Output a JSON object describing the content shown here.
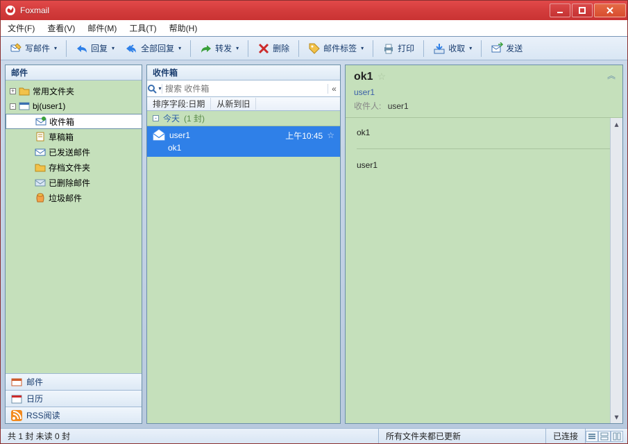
{
  "app": {
    "title": "Foxmail"
  },
  "menu": {
    "file": "文件(F)",
    "view": "查看(V)",
    "mail": "邮件(M)",
    "tools": "工具(T)",
    "help": "帮助(H)"
  },
  "toolbar": {
    "compose": "写邮件",
    "reply": "回复",
    "reply_all": "全部回复",
    "forward": "转发",
    "delete": "删除",
    "tags": "邮件标签",
    "print": "打印",
    "receive": "收取",
    "send": "发送"
  },
  "sidebar": {
    "header": "邮件",
    "tree": {
      "fav": "常用文件夹",
      "account": "bj(user1)",
      "inbox": "收件箱",
      "drafts": "草稿箱",
      "sent": "已发送邮件",
      "archive": "存档文件夹",
      "deleted": "已删除邮件",
      "junk": "垃圾邮件"
    },
    "bottom": {
      "mail": "邮件",
      "calendar": "日历",
      "rss": "RSS阅读"
    }
  },
  "list": {
    "header": "收件箱",
    "search_placeholder": "搜索 收件箱",
    "sort_label": "排序字段:日期",
    "sort_order": "从新到旧",
    "group": {
      "label": "今天",
      "count": "(1 封)"
    },
    "messages": [
      {
        "from": "user1",
        "subject": "ok1",
        "time": "上午10:45"
      }
    ]
  },
  "preview": {
    "subject": "ok1",
    "from": "user1",
    "to_label": "收件人:",
    "to": "user1",
    "body_line1": "ok1",
    "body_line2": "user1"
  },
  "status": {
    "left": "共 1 封 未读 0 封",
    "mid": "所有文件夹都已更新",
    "right": "已连接"
  }
}
